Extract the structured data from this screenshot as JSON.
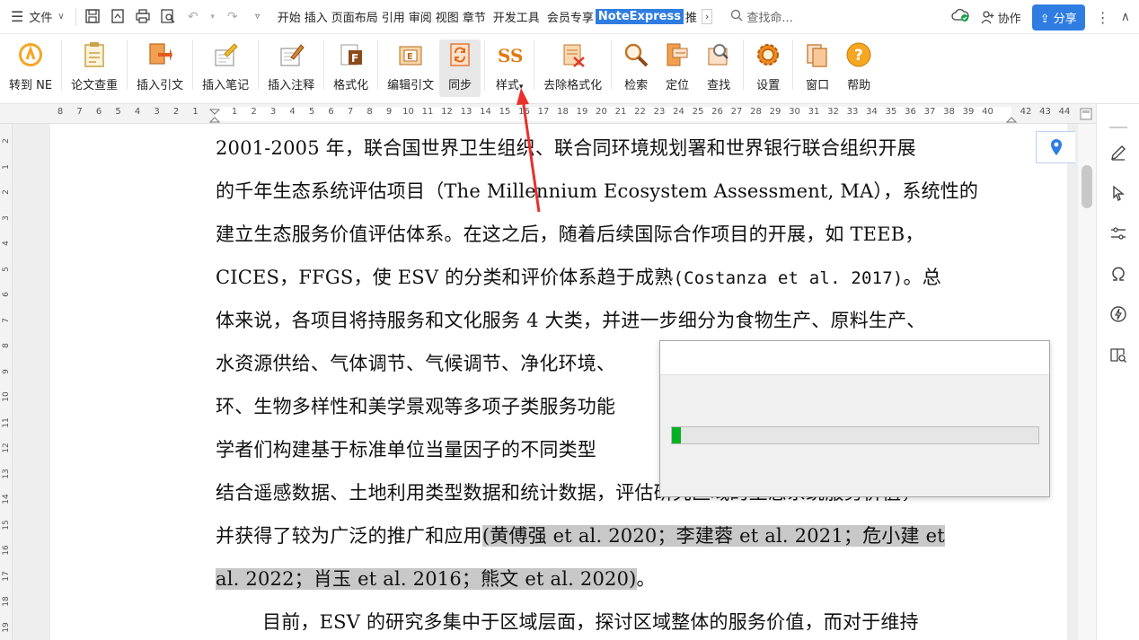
{
  "topbar": {
    "file_label": "文件",
    "menu_tabs": [
      "开始",
      "插入",
      "页面布局",
      "引用",
      "审阅",
      "视图",
      "章节",
      "开发工具",
      "会员专享"
    ],
    "active_tab": "NoteExpress",
    "after_active": "推",
    "more_glyph": "›",
    "search_placeholder": "查找命...",
    "collab_label": "协作",
    "share_label": "分享"
  },
  "ribbon": {
    "buttons": [
      {
        "label": "转到 NE",
        "icon": "ne-logo-icon"
      },
      {
        "label": "论文查重",
        "icon": "clipboard-check-icon"
      },
      {
        "label": "插入引文",
        "icon": "insert-citation-icon"
      },
      {
        "label": "插入笔记",
        "icon": "insert-note-icon"
      },
      {
        "label": "插入注释",
        "icon": "insert-annotation-icon"
      },
      {
        "label": "格式化",
        "icon": "format-icon"
      },
      {
        "label": "编辑引文",
        "icon": "edit-citation-icon"
      },
      {
        "label": "同步",
        "icon": "sync-icon"
      },
      {
        "label": "样式",
        "icon": "style-icon"
      },
      {
        "label": "去除格式化",
        "icon": "remove-format-icon"
      },
      {
        "label": "检索",
        "icon": "search-icon"
      },
      {
        "label": "定位",
        "icon": "locate-icon"
      },
      {
        "label": "查找",
        "icon": "find-icon"
      },
      {
        "label": "设置",
        "icon": "settings-icon"
      },
      {
        "label": "窗口",
        "icon": "window-icon"
      },
      {
        "label": "帮助",
        "icon": "help-icon"
      }
    ],
    "style_dropdown_glyph": "▾"
  },
  "ruler": {
    "left_ticks": [
      "8",
      "7",
      "6",
      "5",
      "4",
      "3",
      "2",
      "1"
    ],
    "right_ticks": [
      "1",
      "2",
      "3",
      "4",
      "5",
      "6",
      "7",
      "8",
      "9",
      "10",
      "11",
      "12",
      "13",
      "14",
      "15",
      "16",
      "17",
      "18",
      "19",
      "20",
      "21",
      "22",
      "23",
      "24",
      "25",
      "26",
      "27",
      "28",
      "29",
      "30",
      "31",
      "32",
      "33",
      "34",
      "35",
      "36",
      "37",
      "38",
      "39",
      "40"
    ],
    "after_ticks": [
      "42",
      "43",
      "44"
    ]
  },
  "vruler": {
    "ticks": [
      "2",
      "1",
      "2",
      "3",
      "4",
      "5",
      "6",
      "7",
      "8",
      "9",
      "10",
      "11",
      "12",
      "13",
      "14",
      "15",
      "16",
      "17",
      "18",
      "19"
    ]
  },
  "document": {
    "line1": "2001-2005 年，联合国世界卫生组织、联合同环境规划署和世界银行联合组织开展",
    "line2": "的千年生态系统评估项目（The Millennium Ecosystem Assessment, MA），系统性的",
    "line3": "建立生态服务价值评估体系。在这之后，随着后续国际合作项目的开展，如 TEEB，",
    "line4_a": "CICES，FFGS，使 ESV 的分类和评价体系趋于成熟",
    "line4_cite": "(Costanza et al. 2017)",
    "line4_b": "。总",
    "line5": "体来说，各项目将持服务和文化服务 4 大类，并进一步细分为食物生产、原料生产、",
    "line6": "水资源供给、气体调节、气候调节、净化环境、",
    "line7": "环、生物多样性和美学景观等多项子类服务功能",
    "line8": "学者们构建基于标准单位当量因子的不同类型",
    "line9": "结合遥感数据、土地利用类型数据和统计数据，评估研究区域的生态系统服务价值，",
    "line10_a": "并获得了较为广泛的推广和应用",
    "line10_hl": "(黄傅强 et al. 2020；李建蓉 et al. 2021；危小建 et",
    "line11_hl": "al. 2022；肖玉 et al. 2016；熊文 et al. 2020)",
    "line11_b": "。",
    "line12": "目前，ESV 的研究多集中于区域层面，探讨区域整体的服务价值，而对于维持"
  },
  "dialog": {
    "title": "",
    "progress": 0.025
  },
  "colors": {
    "accent": "#2f7de1",
    "progress_fill": "#06b025",
    "annotation_arrow": "#e8302c",
    "highlight": "#c8c8c8"
  }
}
